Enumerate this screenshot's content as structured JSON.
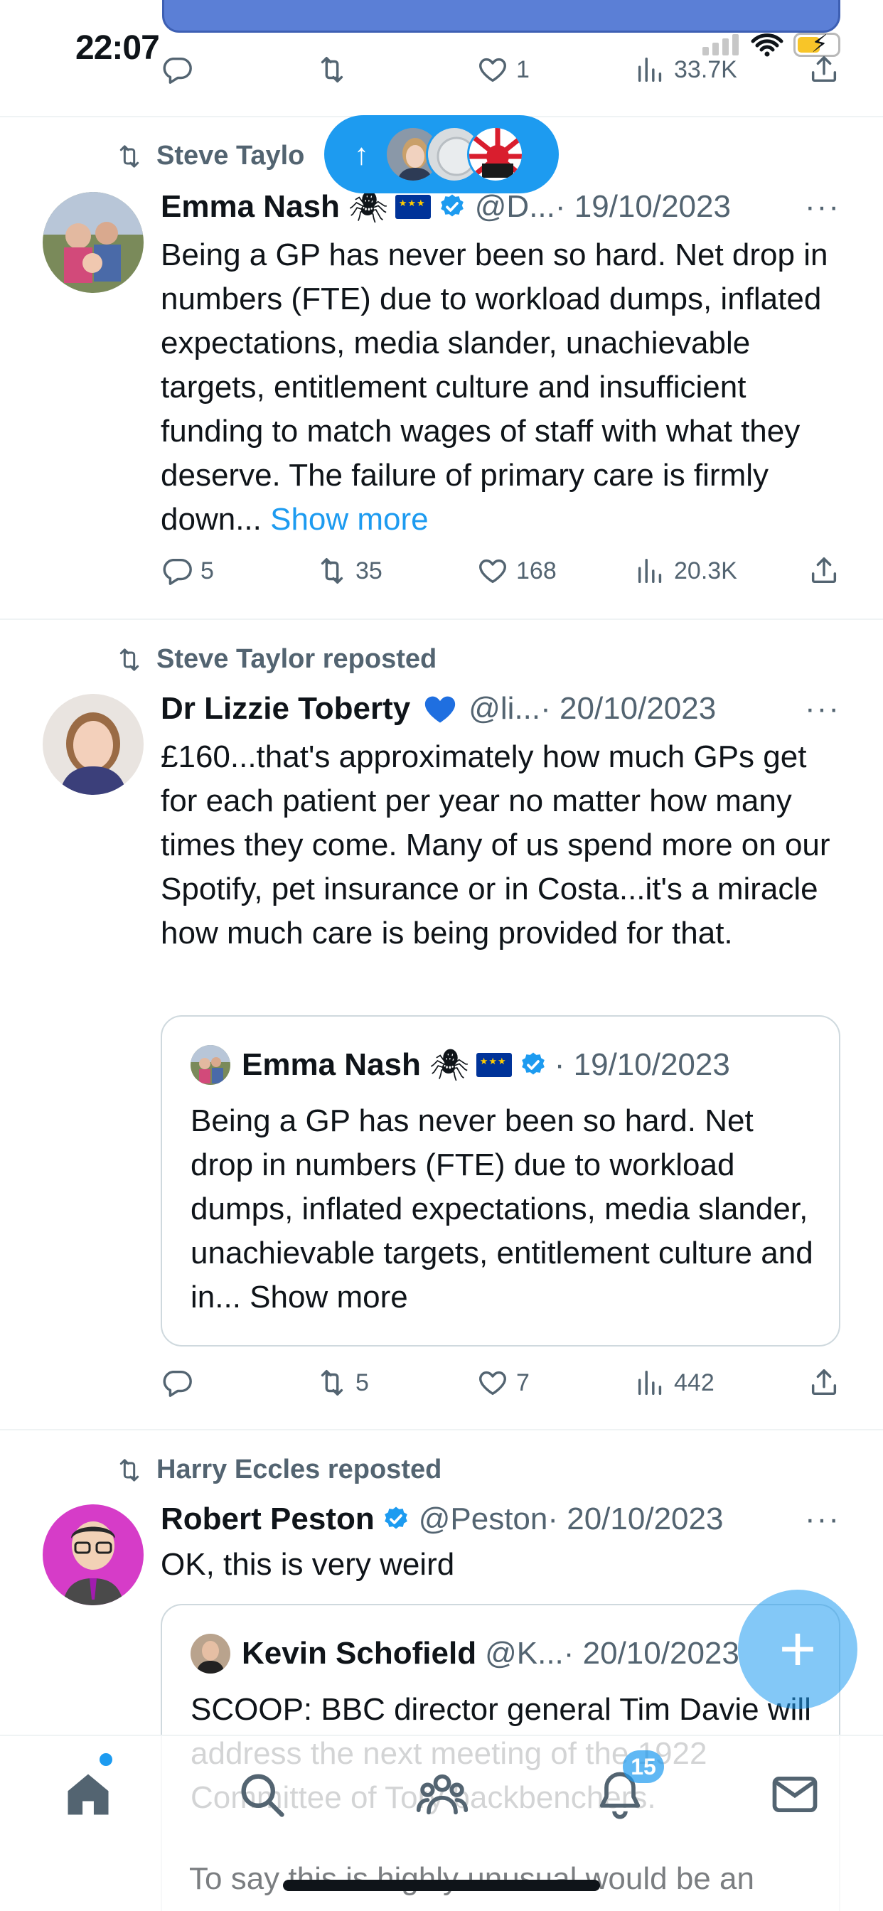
{
  "status": {
    "time": "22:07"
  },
  "top_tweet_actions": {
    "like_count": "1",
    "views": "33.7K"
  },
  "new_posts_pill": {
    "arrow": "↑"
  },
  "tweets": [
    {
      "repost_by": "Steve Taylo",
      "name": "Emma Nash",
      "handle": "@D...",
      "date": "· 19/10/2023",
      "text": "Being a GP has never been so hard. Net drop in numbers (FTE) due to workload dumps, inflated expectations, media slander, unachievable targets, entitlement culture and insufficient funding to match wages of staff with what they deserve. The failure of primary care is firmly down...",
      "show_more": "Show more",
      "replies": "5",
      "reposts": "35",
      "likes": "168",
      "views": "20.3K"
    },
    {
      "repost_by": "Steve Taylor reposted",
      "name": "Dr Lizzie Toberty",
      "handle": "@li...",
      "date": "· 20/10/2023",
      "text": "£160...that's approximately how much GPs get for each patient per year no matter how many times they come. Many of us spend more on our Spotify, pet insurance or in Costa...it's a miracle how much care is being provided for that.",
      "quote": {
        "name": "Emma Nash",
        "date": "· 19/10/2023",
        "text": "Being a GP has never been so hard. Net drop in numbers (FTE) due to workload dumps, inflated expectations, media slander, unachievable targets, entitlement culture and in...",
        "show_more": "Show more"
      },
      "replies": "",
      "reposts": "5",
      "likes": "7",
      "views": "442"
    },
    {
      "repost_by": "Harry Eccles reposted",
      "name": "Robert Peston",
      "handle": "@Peston",
      "date": "· 20/10/2023",
      "text": "OK, this is very weird",
      "quote": {
        "name": "Kevin Schofield",
        "handle": "@K...",
        "date": "· 20/10/2023",
        "text": "SCOOP: BBC director general Tim Davie will address the next meeting of the 1922 Committee of Tory backbenchers.",
        "text2": "To say this is highly unusual would be an"
      }
    }
  ],
  "nav": {
    "notifications_badge": "15",
    "items": [
      "home-icon",
      "search-icon",
      "communities-icon",
      "notifications-icon",
      "messages-icon"
    ]
  },
  "fab": {
    "label": "+"
  },
  "colors": {
    "accent": "#1d9bf0",
    "muted": "#536471",
    "text": "#0f1419"
  }
}
